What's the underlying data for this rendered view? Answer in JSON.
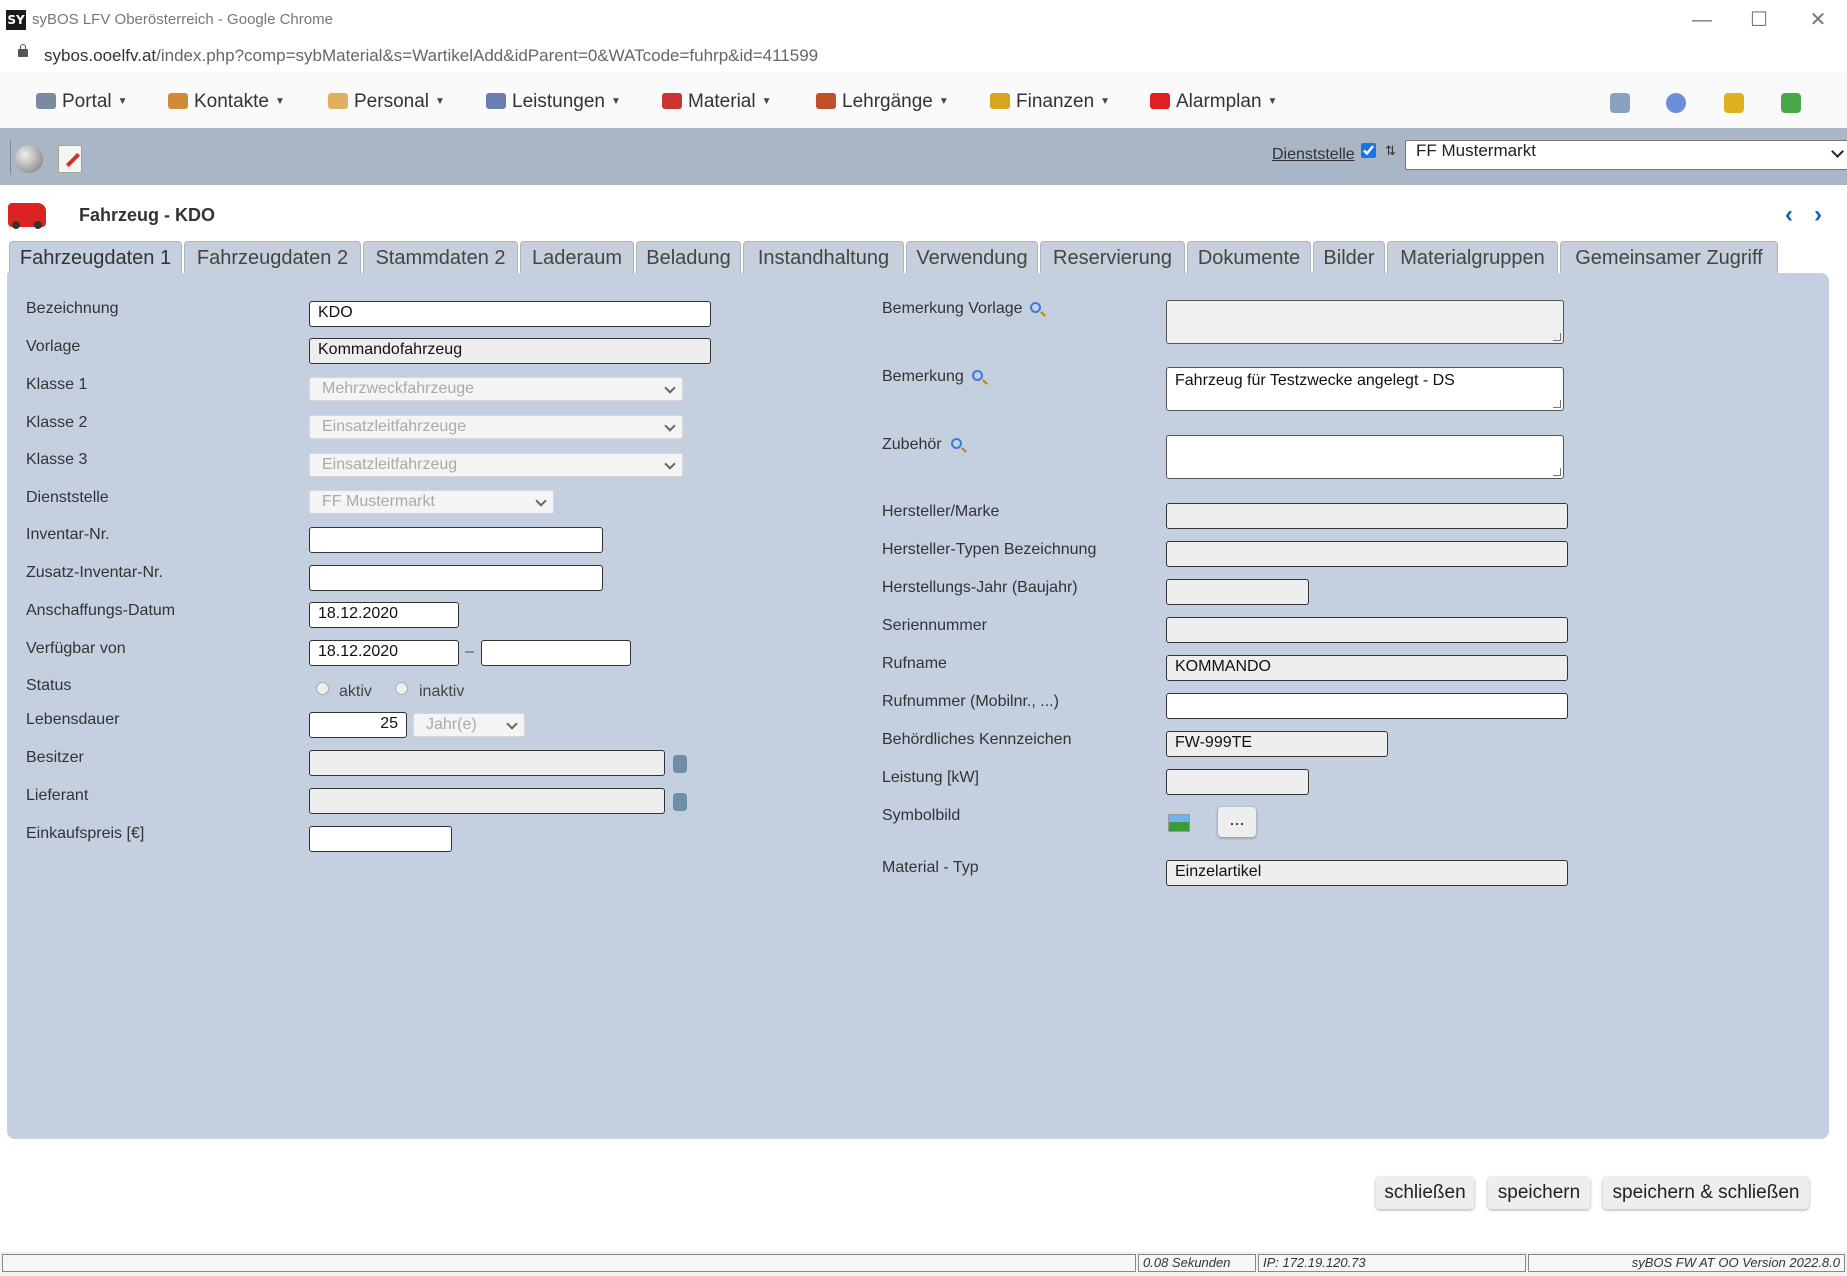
{
  "window": {
    "title": "syBOS LFV Oberösterreich - Google Chrome",
    "logo_text": "SY",
    "url_host": "sybos.ooelfv.at",
    "url_path": "/index.php?comp=sybMaterial&s=WartikelAdd&idParent=0&WATcode=fuhrp&id=411599",
    "controls": {
      "minimize": "—",
      "maximize": "☐",
      "close": "✕"
    }
  },
  "menu": [
    {
      "label": "Portal",
      "icon": "portal-icon",
      "color": "#7a8aa0"
    },
    {
      "label": "Kontakte",
      "icon": "contacts-icon",
      "color": "#d08a3a"
    },
    {
      "label": "Personal",
      "icon": "personal-icon",
      "color": "#e0b060"
    },
    {
      "label": "Leistungen",
      "icon": "gears-icon",
      "color": "#6a7fb0"
    },
    {
      "label": "Material",
      "icon": "truck-icon",
      "color": "#c33"
    },
    {
      "label": "Lehrgänge",
      "icon": "course-icon",
      "color": "#c0502a"
    },
    {
      "label": "Finanzen",
      "icon": "money-icon",
      "color": "#d9a520"
    },
    {
      "label": "Alarmplan",
      "icon": "alarm-icon",
      "color": "#e02020"
    }
  ],
  "toolbar": {
    "dienststelle_label": "Dienststelle",
    "dienststelle_checked": true,
    "sort_glyph": "⇅",
    "dienststelle_value": "FF Mustermarkt"
  },
  "header": {
    "title": "Fahrzeug - KDO",
    "prev": "‹",
    "next": "›"
  },
  "tabs": [
    "Fahrzeugdaten 1",
    "Fahrzeugdaten 2",
    "Stammdaten 2",
    "Laderaum",
    "Beladung",
    "Instandhaltung",
    "Verwendung",
    "Reservierung",
    "Dokumente",
    "Bilder",
    "Materialgruppen",
    "Gemeinsamer Zugriff"
  ],
  "left_form": {
    "bezeichnung": {
      "label": "Bezeichnung",
      "value": "KDO"
    },
    "vorlage": {
      "label": "Vorlage",
      "value": "Kommandofahrzeug"
    },
    "klasse1": {
      "label": "Klasse 1",
      "value": "Mehrzweckfahrzeuge"
    },
    "klasse2": {
      "label": "Klasse 2",
      "value": "Einsatzleitfahrzeuge"
    },
    "klasse3": {
      "label": "Klasse 3",
      "value": "Einsatzleitfahrzeug"
    },
    "dienststelle": {
      "label": "Dienststelle",
      "value": "FF Mustermarkt"
    },
    "inventar": {
      "label": "Inventar-Nr.",
      "value": ""
    },
    "zusatz_inventar": {
      "label": "Zusatz-Inventar-Nr.",
      "value": ""
    },
    "anschaffung": {
      "label": "Anschaffungs-Datum",
      "value": "18.12.2020"
    },
    "verfuegbar": {
      "label": "Verfügbar von",
      "from": "18.12.2020",
      "separator": "–",
      "to": ""
    },
    "status": {
      "label": "Status",
      "opt_active": "aktiv",
      "opt_inactive": "inaktiv"
    },
    "lebensdauer": {
      "label": "Lebensdauer",
      "value": "25",
      "unit": "Jahr(e)"
    },
    "besitzer": {
      "label": "Besitzer",
      "value": ""
    },
    "lieferant": {
      "label": "Lieferant",
      "value": ""
    },
    "einkaufspreis": {
      "label": "Einkaufspreis [€]",
      "value": ""
    }
  },
  "right_form": {
    "bemerkung_vorlage": {
      "label": "Bemerkung Vorlage",
      "value": ""
    },
    "bemerkung": {
      "label": "Bemerkung",
      "value": "Fahrzeug für Testzwecke angelegt - DS"
    },
    "zubehoer": {
      "label": "Zubehör",
      "value": ""
    },
    "hersteller": {
      "label": "Hersteller/Marke",
      "value": ""
    },
    "hersteller_typ": {
      "label": "Hersteller-Typen Bezeichnung",
      "value": ""
    },
    "baujahr": {
      "label": "Herstellungs-Jahr (Baujahr)",
      "value": ""
    },
    "seriennummer": {
      "label": "Seriennummer",
      "value": ""
    },
    "rufname": {
      "label": "Rufname",
      "value": "KOMMANDO"
    },
    "rufnummer": {
      "label": "Rufnummer (Mobilnr., ...)",
      "value": ""
    },
    "kennzeichen": {
      "label": "Behördliches Kennzeichen",
      "value": "FW-999TE"
    },
    "leistung": {
      "label": "Leistung [kW]",
      "value": ""
    },
    "symbolbild": {
      "label": "Symbolbild",
      "button": "..."
    },
    "material_typ": {
      "label": "Material - Typ",
      "value": "Einzelartikel"
    }
  },
  "actions": {
    "close": "schließen",
    "save": "speichern",
    "save_close": "speichern & schließen"
  },
  "status_bar": {
    "time": "0.08 Sekunden",
    "ip": "IP: 172.19.120.73",
    "version": "syBOS FW AT OO Version 2022.8.0"
  }
}
